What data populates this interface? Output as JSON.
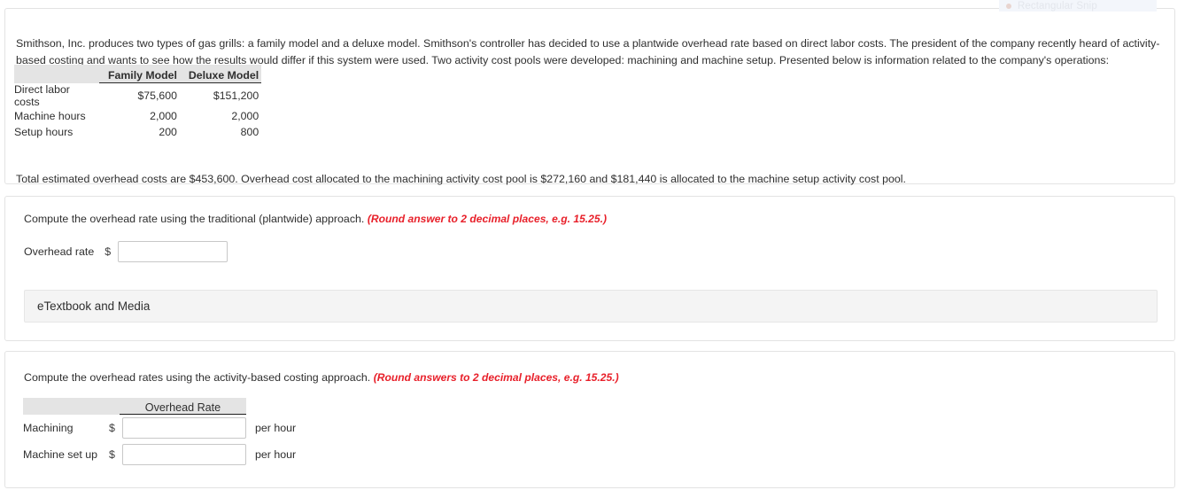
{
  "snip_overlay": {
    "label": "Rectangular Snip",
    "dot_icon": "record-dot-icon"
  },
  "intro": {
    "paragraph": "Smithson, Inc. produces two types of gas grills: a family model and a deluxe model. Smithson's controller has decided to use a plantwide overhead rate based on direct labor costs. The president of the company recently heard of activity-based costing and wants to see how the results would differ if this system were used. Two activity cost pools were developed: machining and machine setup. Presented below is information related to the company's operations:",
    "total_paragraph": "Total estimated overhead costs are $453,600. Overhead cost allocated to the machining activity cost pool is $272,160 and $181,440 is allocated to the machine setup activity cost pool.",
    "table": {
      "headers": [
        "",
        "Family Model",
        "Deluxe Model"
      ],
      "rows": [
        {
          "label": "Direct labor costs",
          "family": "$75,600",
          "deluxe": "$151,200"
        },
        {
          "label": "Machine hours",
          "family": "2,000",
          "deluxe": "2,000"
        },
        {
          "label": "Setup hours",
          "family": "200",
          "deluxe": "800"
        }
      ]
    }
  },
  "question_traditional": {
    "prompt": "Compute the overhead rate using the traditional (plantwide) approach.",
    "hint": "(Round answer to 2 decimal places, e.g. 15.25.)",
    "answer_label": "Overhead rate",
    "dollar_sign": "$",
    "input_value": "",
    "input_placeholder": "",
    "etextbook_label": "eTextbook and Media"
  },
  "question_abc": {
    "prompt": "Compute the overhead rates using the activity-based costing approach.",
    "hint": "(Round answers to 2 decimal places, e.g. 15.25.)",
    "table": {
      "header": "Overhead Rate",
      "rows": [
        {
          "label": "Machining",
          "dollar": "$",
          "value": "",
          "unit": "per hour"
        },
        {
          "label": "Machine set up",
          "dollar": "$",
          "value": "",
          "unit": "per hour"
        }
      ]
    }
  },
  "colors": {
    "hint_red": "#e8202a",
    "table_header_bg": "#e4e4e4",
    "card_border": "#e3e3e3",
    "etextbook_bg": "#f4f4f4"
  }
}
